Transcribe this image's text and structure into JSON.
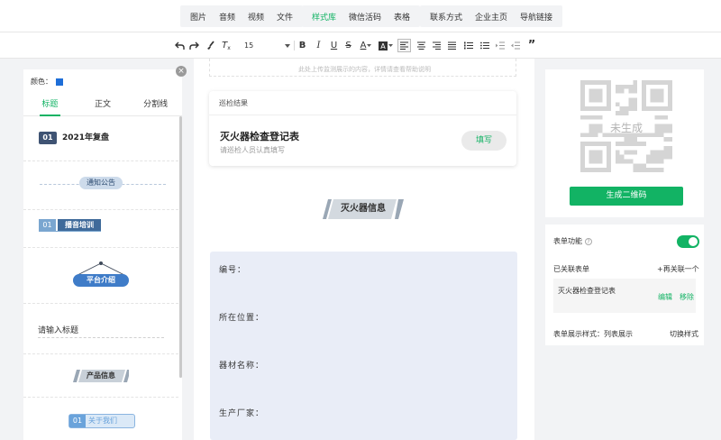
{
  "topbar": {
    "groups": [
      [
        "图片",
        "音频",
        "视频",
        "文件"
      ],
      [
        "样式库",
        "微信活码",
        "表格"
      ],
      [
        "联系方式",
        "企业主页",
        "导航链接"
      ]
    ],
    "active": "样式库"
  },
  "toolbar": {
    "font_size": "15",
    "buttons": [
      "undo",
      "redo",
      "format-painter",
      "clear-format",
      "bold",
      "italic",
      "underline",
      "strikethrough",
      "font-color",
      "background-color",
      "align-left",
      "align-center",
      "align-right",
      "align-justify",
      "ordered-list",
      "unordered-list",
      "indent",
      "outdent",
      "quote"
    ]
  },
  "left_panel": {
    "color_label": "颜色：",
    "color_value": "#1e6ed8",
    "tabs": [
      "标题",
      "正文",
      "分割线"
    ],
    "active_tab": "标题",
    "templates": {
      "t1_num": "01",
      "t1_text": "2021年复盘",
      "t2_text": "通知公告",
      "t3_num": "01",
      "t3_text": "播音培训",
      "t4_text": "平台介绍",
      "t5_text": "请输入标题",
      "t6_text": "产品信息",
      "t7_num": "01",
      "t7_text": "关于我们"
    }
  },
  "center": {
    "top_hint": "此处上传监测展示的内容，详情请查看帮助说明",
    "card": {
      "header": "巡检结果",
      "title": "灭火器检查登记表",
      "subtitle": "请巡检人员认真填写",
      "button": "填写"
    },
    "section_title": "灭火器信息",
    "form_fields": [
      "编号：",
      "所在位置：",
      "器材名称：",
      "生产厂家："
    ]
  },
  "right_panel": {
    "qr_placeholder": "未生成",
    "generate_button": "生成二维码",
    "form_function_label": "表单功能",
    "form_function_on": true,
    "linked_forms_label": "已关联表单",
    "link_more": "+再关联一个",
    "linked_form_name": "灭火器检查登记表",
    "edit": "编辑",
    "remove": "移除",
    "display_style_label": "表单展示样式：列表展示",
    "switch_style": "切换样式"
  },
  "colors": {
    "accent": "#12b364",
    "template_blue": "#3f5373"
  }
}
